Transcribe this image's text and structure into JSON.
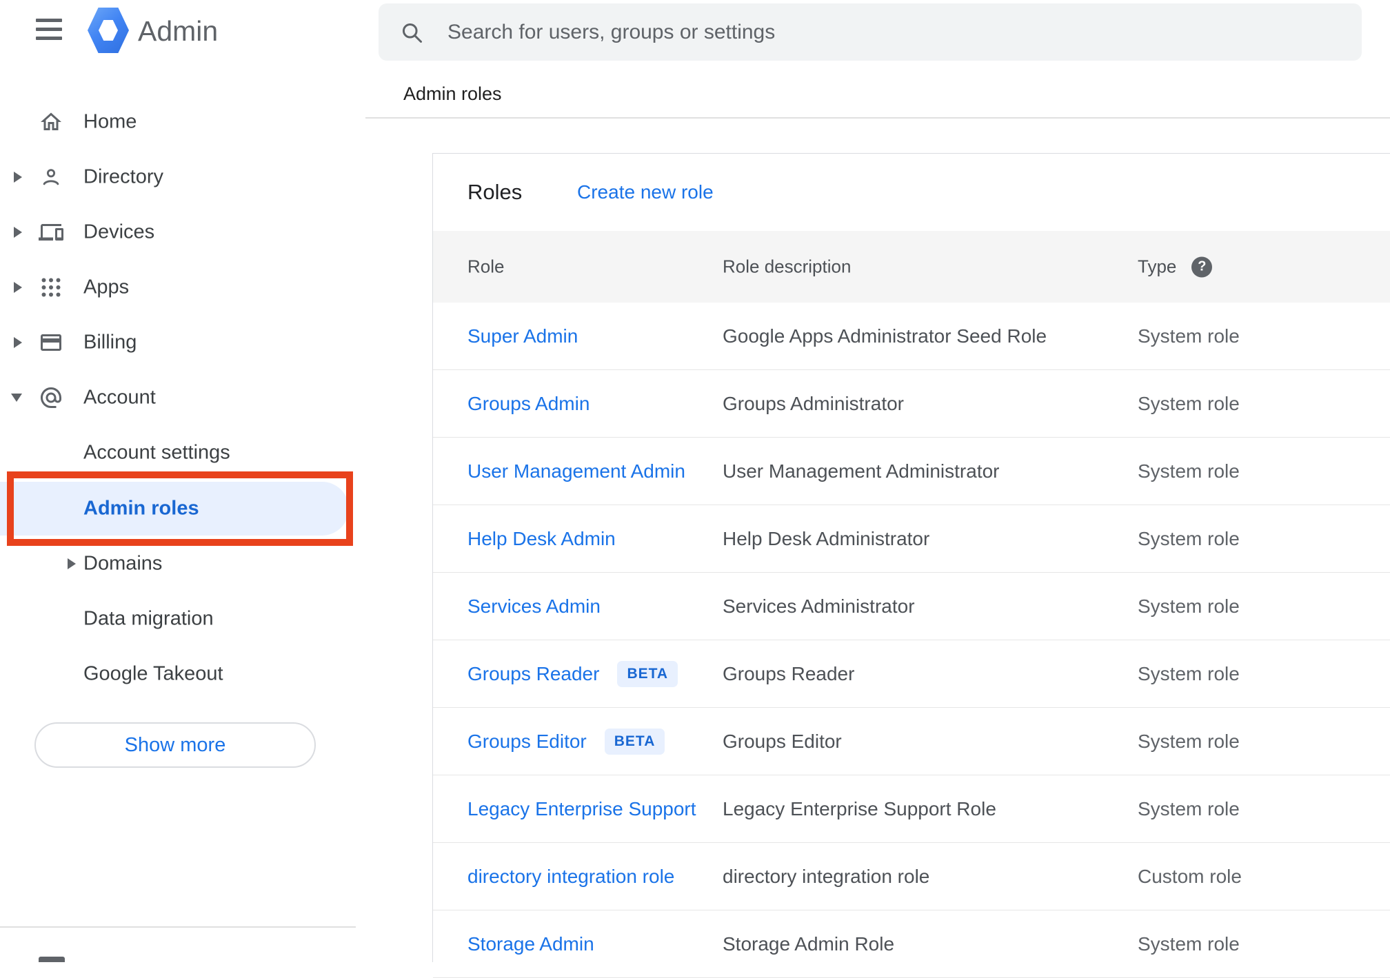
{
  "app": {
    "logo_text": "Admin"
  },
  "search": {
    "placeholder": "Search for users, groups or settings"
  },
  "breadcrumb": "Admin roles",
  "sidebar": {
    "items": [
      {
        "label": "Home"
      },
      {
        "label": "Directory"
      },
      {
        "label": "Devices"
      },
      {
        "label": "Apps"
      },
      {
        "label": "Billing"
      },
      {
        "label": "Account"
      }
    ],
    "account_children": [
      {
        "label": "Account settings"
      },
      {
        "label": "Admin roles",
        "selected": true
      },
      {
        "label": "Domains"
      },
      {
        "label": "Data migration"
      },
      {
        "label": "Google Takeout"
      }
    ],
    "show_more_label": "Show more"
  },
  "roles_card": {
    "title": "Roles",
    "create_link": "Create new role",
    "beta_label": "BETA",
    "columns": {
      "role": "Role",
      "description": "Role description",
      "type": "Type"
    },
    "rows": [
      {
        "role": "Super Admin",
        "description": "Google Apps Administrator Seed Role",
        "type": "System role"
      },
      {
        "role": "Groups Admin",
        "description": "Groups Administrator",
        "type": "System role"
      },
      {
        "role": "User Management Admin",
        "description": "User Management Administrator",
        "type": "System role"
      },
      {
        "role": "Help Desk Admin",
        "description": "Help Desk Administrator",
        "type": "System role"
      },
      {
        "role": "Services Admin",
        "description": "Services Administrator",
        "type": "System role"
      },
      {
        "role": "Groups Reader",
        "beta": true,
        "description": "Groups Reader",
        "type": "System role"
      },
      {
        "role": "Groups Editor",
        "beta": true,
        "description": "Groups Editor",
        "type": "System role"
      },
      {
        "role": "Legacy Enterprise Support",
        "description": "Legacy Enterprise Support Role",
        "type": "System role"
      },
      {
        "role": "directory integration role",
        "description": "directory integration role",
        "type": "Custom role"
      },
      {
        "role": "Storage Admin",
        "description": "Storage Admin Role",
        "type": "System role"
      }
    ]
  },
  "colors": {
    "link_blue": "#1a73e8",
    "selected_blue": "#1967d2",
    "selected_bg": "#e8f0fe",
    "beta_bg": "#e8f0fe",
    "annotation_red": "#e8421c",
    "brand_blue": "#4285f4",
    "icon_gray": "#5f6368"
  }
}
